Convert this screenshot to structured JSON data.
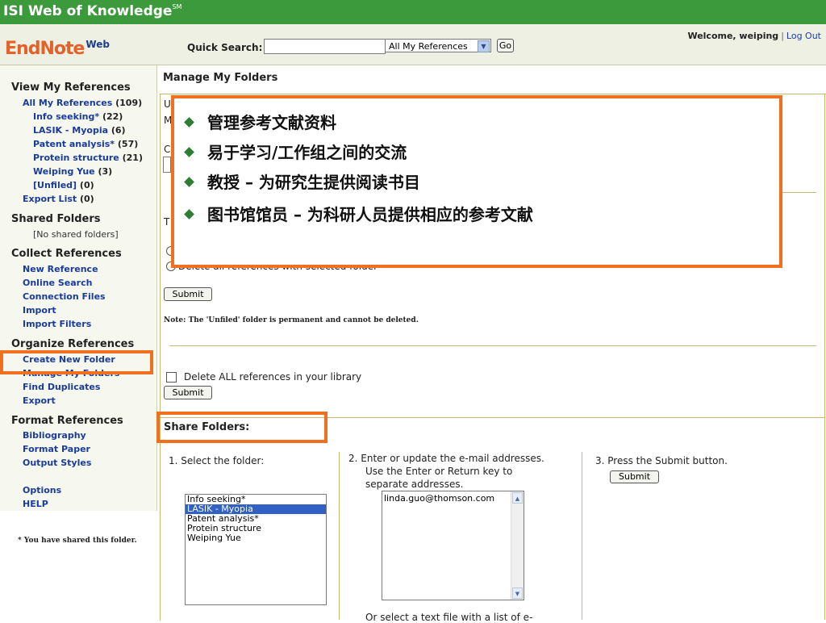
{
  "topbar": {
    "title": "ISI Web of Knowledge",
    "title_mark": "SM"
  },
  "header": {
    "logo": "EndNote",
    "logo_suffix": "Web",
    "quick_search_label": "Quick Search:",
    "quick_search_value": "",
    "scope_selected": "All My References",
    "go_label": "Go",
    "welcome_prefix": "Welcome, weiping",
    "logout_label": "Log Out"
  },
  "sidebar": {
    "view_heading": "View My References",
    "all_refs": {
      "label": "All My References",
      "count": "(109)"
    },
    "folders": [
      {
        "label": "Info seeking*",
        "count": "(22)"
      },
      {
        "label": "LASIK - Myopia",
        "count": "(6)"
      },
      {
        "label": "Patent analysis*",
        "count": "(57)"
      },
      {
        "label": "Protein structure",
        "count": "(21)"
      },
      {
        "label": "Weiping Yue",
        "count": "(3)"
      },
      {
        "label": "[Unfiled]",
        "count": "(0)"
      }
    ],
    "export_list": {
      "label": "Export List",
      "count": "(0)"
    },
    "shared_heading": "Shared Folders",
    "no_shared": "[No shared folders]",
    "collect_heading": "Collect References",
    "collect_items": [
      "New Reference",
      "Online Search",
      "Connection Files",
      "Import",
      "Import Filters"
    ],
    "organize_heading": "Organize References",
    "organize_items": [
      "Create New Folder",
      "Manage My Folders",
      "Find Duplicates",
      "Export"
    ],
    "format_heading": "Format References",
    "format_items": [
      "Bibliography",
      "Format Paper",
      "Output Styles"
    ],
    "other_items": [
      "Options",
      "HELP"
    ],
    "shared_note": "* You have shared this folder."
  },
  "main": {
    "title": "Manage My Folders",
    "frag_u": "U",
    "frag_m": "M",
    "frag_c": "C",
    "frag_t": "T",
    "delete_with_folder": "Delete all references with selected folder",
    "submit_label": "Submit",
    "unfiled_note": "Note: The 'Unfiled' folder is permanent and cannot be deleted.",
    "delete_all_label": "Delete ALL references in your library",
    "submit2_label": "Submit",
    "share_heading": "Share Folders:",
    "step1": "1. Select the folder:",
    "step2_lines": [
      "2. Enter or update the e-mail addresses.",
      "Use the Enter or Return key to",
      "separate addresses."
    ],
    "step3": "3. Press the Submit button.",
    "submit3_label": "Submit",
    "folder_options": [
      "Info seeking*",
      "LASIK - Myopia",
      "Patent analysis*",
      "Protein structure",
      "Weiping Yue"
    ],
    "selected_folder": "LASIK - Myopia",
    "email_value": "linda.guo@thomson.com",
    "bottom_text": "Or select a text file with a list of e-"
  },
  "overlay": {
    "bullets": [
      "管理参考文献资料",
      "易于学习/工作组之间的交流",
      "教授 – 为研究生提供阅读书目",
      "图书馆馆员 – 为科研人员提供相应的参考文献"
    ]
  },
  "colors": {
    "topbar": "#3c9a3c",
    "highlight": "#f07020",
    "link": "#1a3c9a",
    "bullet": "#2e7d32"
  }
}
